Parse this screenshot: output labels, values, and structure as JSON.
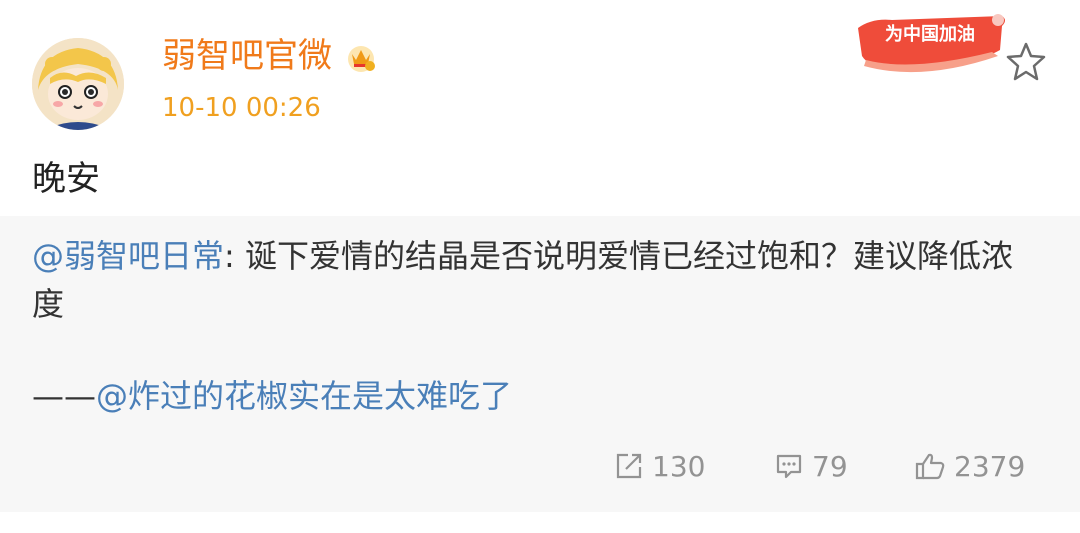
{
  "post": {
    "author": "弱智吧官微",
    "timestamp": "10-10 00:26",
    "text": "晚安",
    "banner_text": "为中国加油"
  },
  "repost": {
    "mention_user": "@弱智吧日常",
    "separator": ": ",
    "text": "诞下爱情的结晶是否说明爱情已经过饱和？建议降低浓度",
    "attribution_prefix": "——",
    "attribution_user": "@炸过的花椒实在是太难吃了",
    "repost_count": "130",
    "comment_count": "79",
    "like_count": "2379"
  },
  "icons": {
    "vip": "crown-badge-icon",
    "favorite": "star-icon",
    "repost": "share-icon",
    "comment": "comment-icon",
    "like": "thumbs-up-icon"
  },
  "colors": {
    "author": "#f07a1a",
    "timestamp": "#f0a020",
    "mention": "#4a7fb8",
    "repost_bg": "#f7f7f7",
    "action_text": "#939393",
    "banner_red": "#e8362c"
  }
}
